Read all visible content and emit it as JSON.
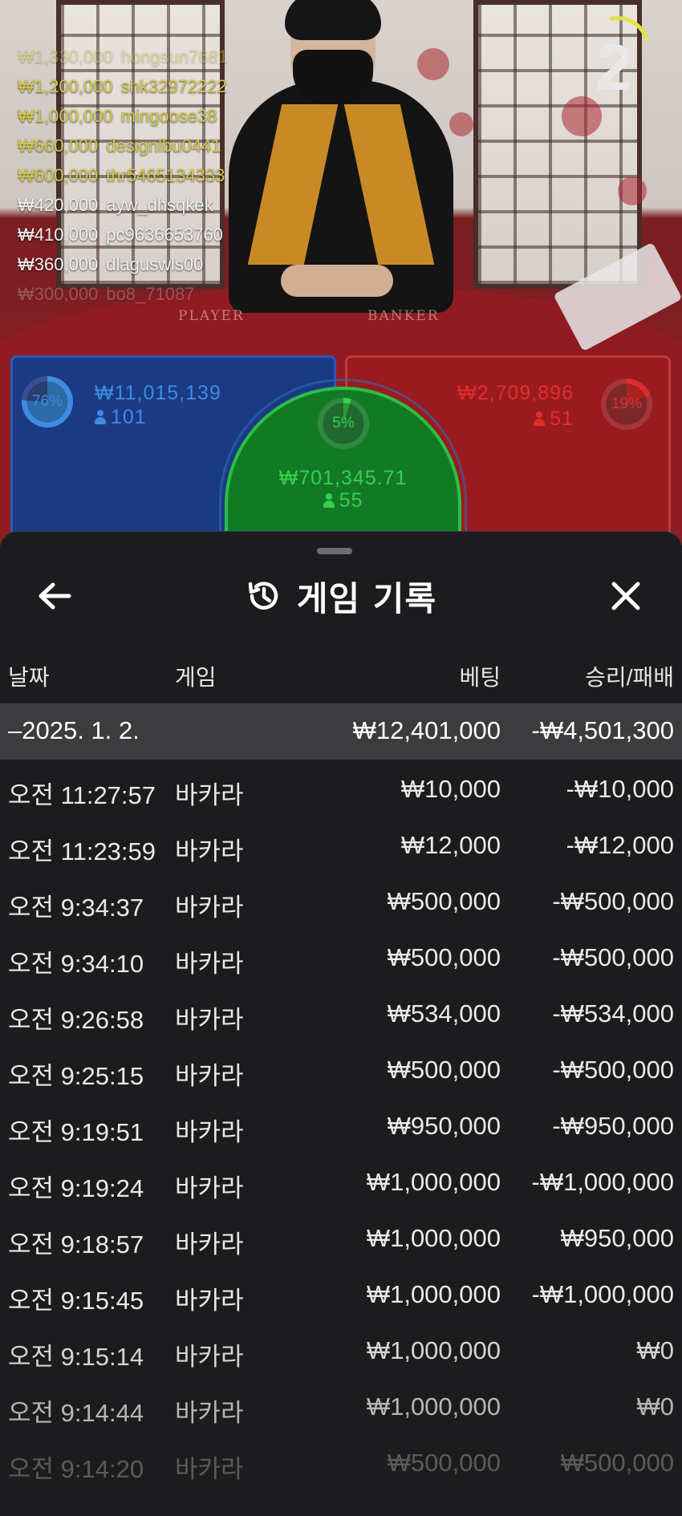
{
  "stream": {
    "round_number": "2",
    "leaderboard": [
      {
        "amount": "₩1,330,000",
        "user": "hongsun7681",
        "color": "#d4c84a"
      },
      {
        "amount": "₩1,200,000",
        "user": "shk32972222",
        "color": "#d4c84a"
      },
      {
        "amount": "₩1,000,000",
        "user": "mingoose38",
        "color": "#d4c84a"
      },
      {
        "amount": "₩660,000",
        "user": "designlbu0441",
        "color": "#d4c84a"
      },
      {
        "amount": "₩600,000",
        "user": "thr5465134333",
        "color": "#d4c84a"
      },
      {
        "amount": "₩420,000",
        "user": "ayw_dhsqkek",
        "color": "#f0f0f0"
      },
      {
        "amount": "₩410,000",
        "user": "pc9636653760",
        "color": "#f0f0f0"
      },
      {
        "amount": "₩360,000",
        "user": "dlaguswls00",
        "color": "#f0f0f0"
      },
      {
        "amount": "₩300,000",
        "user": "bo8_71087",
        "color": "#f0f0f0"
      }
    ],
    "table_labels": {
      "player": "PLAYER",
      "banker": "BANKER"
    }
  },
  "bets": {
    "player": {
      "percent": "76%",
      "percent_value": 76,
      "amount": "₩11,015,139",
      "players": "101",
      "color": "#3d8ce0"
    },
    "tie": {
      "percent": "5%",
      "percent_value": 5,
      "amount": "₩701,345.71",
      "players": "55",
      "color": "#35d04f"
    },
    "banker": {
      "percent": "19%",
      "percent_value": 19,
      "amount": "₩2,709,896",
      "players": "51",
      "color": "#e02d2d"
    }
  },
  "history": {
    "title": "게임 기록",
    "icons": {
      "back": "back-arrow-icon",
      "history": "history-icon",
      "close": "close-icon"
    },
    "columns": {
      "date": "날짜",
      "game": "게임",
      "bet": "베팅",
      "result": "승리/패배"
    },
    "date_group": {
      "label": "–2025. 1. 2.",
      "bet": "₩12,401,000",
      "result": "-₩4,501,300"
    },
    "rows": [
      {
        "time": "오전 11:27:57",
        "game": "바카라",
        "bet": "₩10,000",
        "result": "-₩10,000"
      },
      {
        "time": "오전 11:23:59",
        "game": "바카라",
        "bet": "₩12,000",
        "result": "-₩12,000"
      },
      {
        "time": "오전 9:34:37",
        "game": "바카라",
        "bet": "₩500,000",
        "result": "-₩500,000"
      },
      {
        "time": "오전 9:34:10",
        "game": "바카라",
        "bet": "₩500,000",
        "result": "-₩500,000"
      },
      {
        "time": "오전 9:26:58",
        "game": "바카라",
        "bet": "₩534,000",
        "result": "-₩534,000"
      },
      {
        "time": "오전 9:25:15",
        "game": "바카라",
        "bet": "₩500,000",
        "result": "-₩500,000"
      },
      {
        "time": "오전 9:19:51",
        "game": "바카라",
        "bet": "₩950,000",
        "result": "-₩950,000"
      },
      {
        "time": "오전 9:19:24",
        "game": "바카라",
        "bet": "₩1,000,000",
        "result": "-₩1,000,000"
      },
      {
        "time": "오전 9:18:57",
        "game": "바카라",
        "bet": "₩1,000,000",
        "result": "₩950,000"
      },
      {
        "time": "오전 9:15:45",
        "game": "바카라",
        "bet": "₩1,000,000",
        "result": "-₩1,000,000"
      },
      {
        "time": "오전 9:15:14",
        "game": "바카라",
        "bet": "₩1,000,000",
        "result": "₩0"
      },
      {
        "time": "오전 9:14:44",
        "game": "바카라",
        "bet": "₩1,000,000",
        "result": "₩0"
      },
      {
        "time": "오전 9:14:20",
        "game": "바카라",
        "bet": "₩500,000",
        "result": "₩500,000"
      }
    ]
  }
}
